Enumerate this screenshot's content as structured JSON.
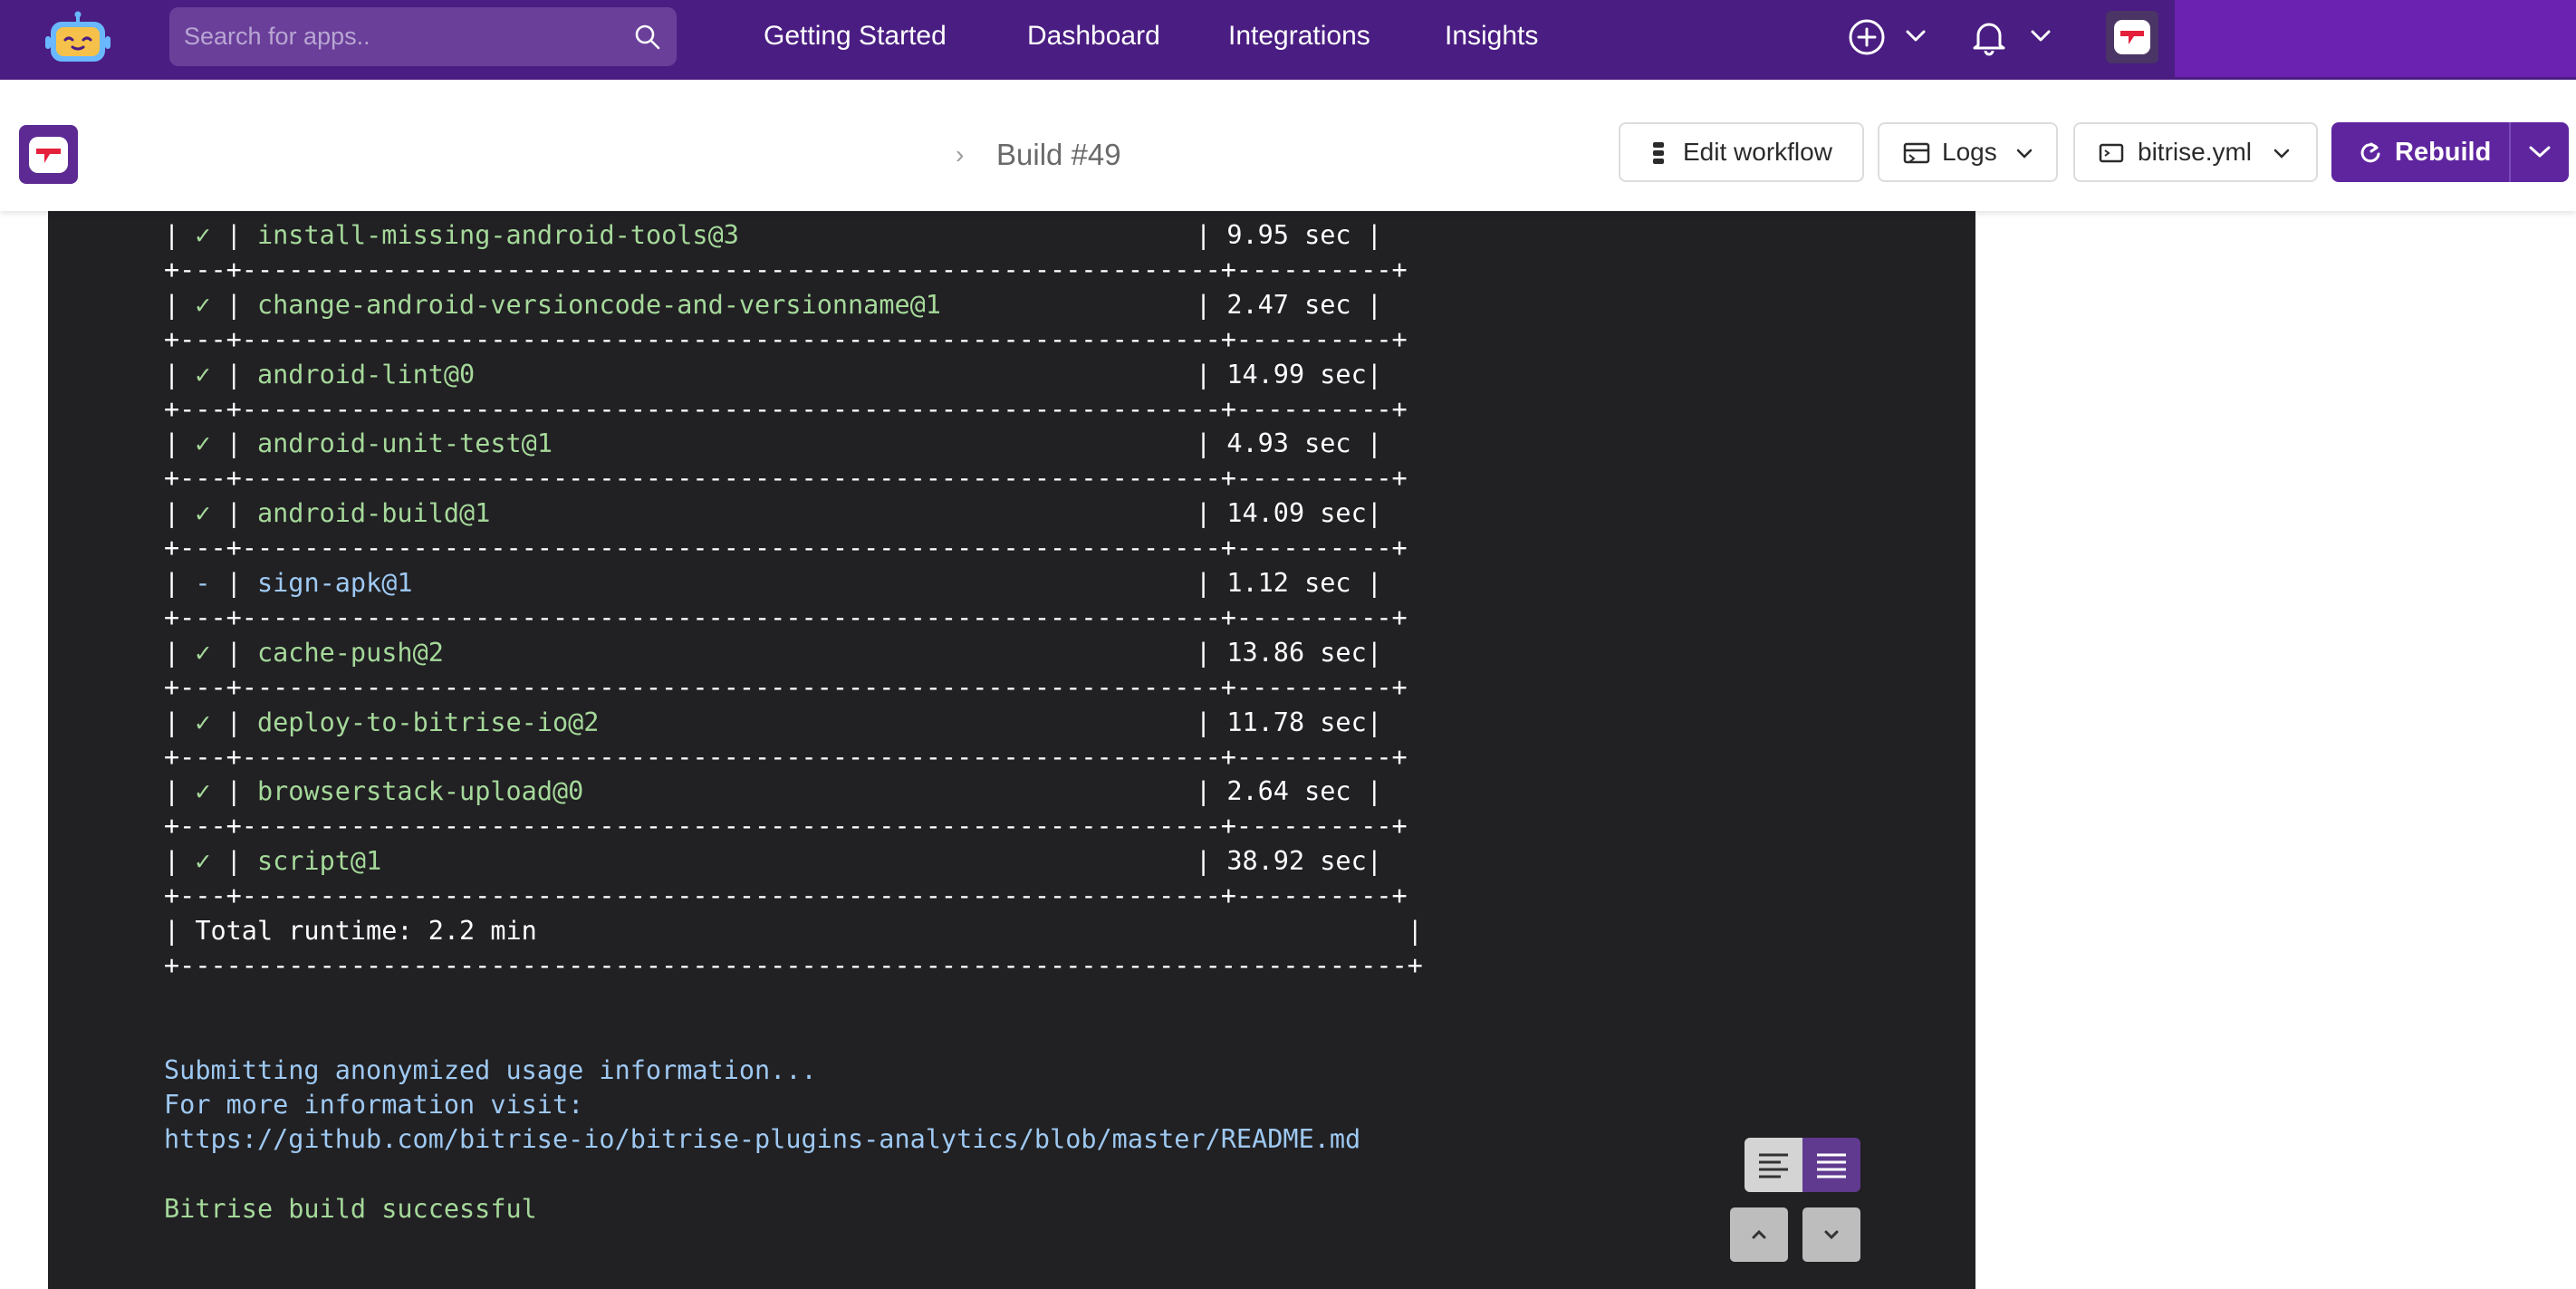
{
  "topnav": {
    "search_placeholder": "Search for apps..",
    "links": [
      "Getting Started",
      "Dashboard",
      "Integrations",
      "Insights"
    ]
  },
  "build": {
    "title": "Build #49",
    "buttons": {
      "edit_workflow": "Edit workflow",
      "logs": "Logs",
      "bitrise_yml": "bitrise.yml",
      "rebuild": "Rebuild"
    }
  },
  "log": {
    "steps": [
      {
        "status": "✓",
        "name": "install-missing-android-tools@3",
        "time": "| 9.95 sec |"
      },
      {
        "status": "✓",
        "name": "change-android-versioncode-and-versionname@1",
        "time": "| 2.47 sec |"
      },
      {
        "status": "✓",
        "name": "android-lint@0",
        "time": "| 14.99 sec|"
      },
      {
        "status": "✓",
        "name": "android-unit-test@1",
        "time": "| 4.93 sec |"
      },
      {
        "status": "✓",
        "name": "android-build@1",
        "time": "| 14.09 sec|"
      },
      {
        "status": "-",
        "name": "sign-apk@1",
        "time": "| 1.12 sec |"
      },
      {
        "status": "✓",
        "name": "cache-push@2",
        "time": "| 13.86 sec|"
      },
      {
        "status": "✓",
        "name": "deploy-to-bitrise-io@2",
        "time": "| 11.78 sec|"
      },
      {
        "status": "✓",
        "name": "browserstack-upload@0",
        "time": "| 2.64 sec |"
      },
      {
        "status": "✓",
        "name": "script@1",
        "time": "| 38.92 sec|"
      }
    ],
    "separator": "+---+---------------------------------------------------------------+----------+",
    "total_bottom": "+-------------------------------------------------------------------------------+",
    "total_line": "| Total runtime: 2.2 min                                                        |",
    "submitting": "Submitting anonymized usage information...",
    "more_info": "For more information visit:",
    "url": "https://github.com/bitrise-io/bitrise-plugins-analytics/blob/master/README.md",
    "success": "Bitrise build successful"
  },
  "colors": {
    "nav_bg": "#4a1d82",
    "accent": "#5f259f",
    "terminal_bg": "#212023",
    "log_green": "#a5d99a",
    "log_blue": "#9ec9f2"
  }
}
